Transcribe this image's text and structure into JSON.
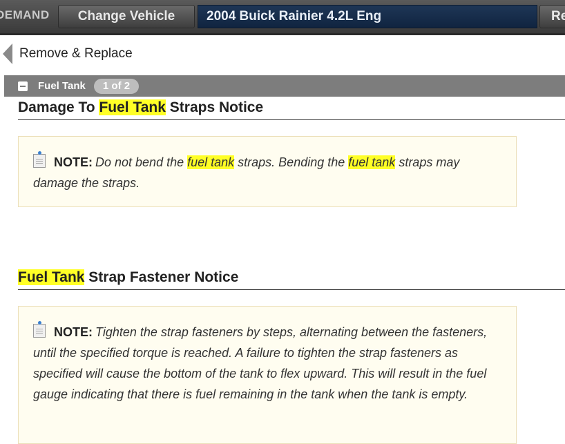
{
  "topbar": {
    "brand": "DEMAND",
    "change_vehicle_label": "Change Vehicle",
    "vehicle_label": "2004 Buick Rainier 4.2L Eng",
    "right_button_label": "Re"
  },
  "nav": {
    "back_label": "Remove & Replace"
  },
  "section": {
    "title": "Fuel Tank",
    "pager": "1 of 2"
  },
  "notices": [
    {
      "heading_parts": {
        "pre": "Damage To ",
        "highlight": "Fuel Tank",
        "post": " Straps Notice"
      },
      "note_label": "NOTE:",
      "note_parts": {
        "a": "Do not bend the ",
        "h1": "fuel tank",
        "b": " straps. Bending the ",
        "h2": "fuel tank",
        "c": " straps may damage the straps."
      }
    },
    {
      "heading_parts": {
        "pre": "",
        "highlight": "Fuel Tank",
        "post": " Strap Fastener Notice"
      },
      "note_label": "NOTE:",
      "note_text": "Tighten the strap fasteners by steps, alternating between the fasteners, until the specified torque is reached. A failure to tighten the strap fasteners as specified will cause the bottom of the tank to flex upward. This will result in the fuel gauge indicating that there is fuel remaining in the tank when the tank is empty."
    }
  ],
  "colors": {
    "highlight": "#ffff26",
    "section_bar": "#7d7d7d",
    "vehicle_bar": "#1e3656",
    "note_background": "#fffdf0"
  },
  "icons": [
    "back-arrow-icon",
    "collapse-icon",
    "note-icon"
  ]
}
